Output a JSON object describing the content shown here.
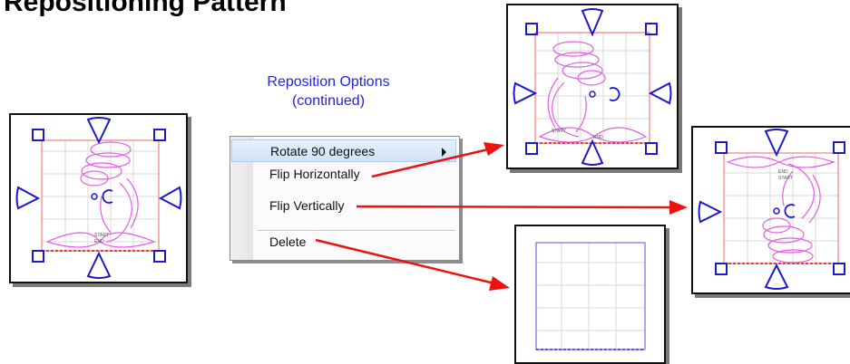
{
  "page": {
    "heading": "Repositioning Pattern",
    "subtitle_line1": "Reposition Options",
    "subtitle_line2": "(continued)"
  },
  "context_menu": {
    "items": [
      {
        "label": "Rotate 90 degrees",
        "has_submenu": true,
        "highlighted": true
      },
      {
        "label": "Flip Horizontally",
        "has_submenu": false,
        "highlighted": false
      },
      {
        "label": "Flip Vertically",
        "has_submenu": false,
        "highlighted": false
      },
      {
        "label": "Delete",
        "has_submenu": false,
        "highlighted": false
      }
    ]
  },
  "previews": {
    "original": {
      "start_label": "START",
      "end_label": "END"
    },
    "flip_horizontal": {
      "start_label": "START",
      "end_label": "END"
    },
    "flip_vertical": {
      "start_label": "START",
      "end_label": "END"
    }
  },
  "colors": {
    "handle": "#1a1acc",
    "pattern": "#e65ce6",
    "arrow": "#ee1111",
    "bounds": "#f08080",
    "grid": "#d8d8d8",
    "deleted_outline": "#6a6aff",
    "accent_text": "#2424d8"
  }
}
